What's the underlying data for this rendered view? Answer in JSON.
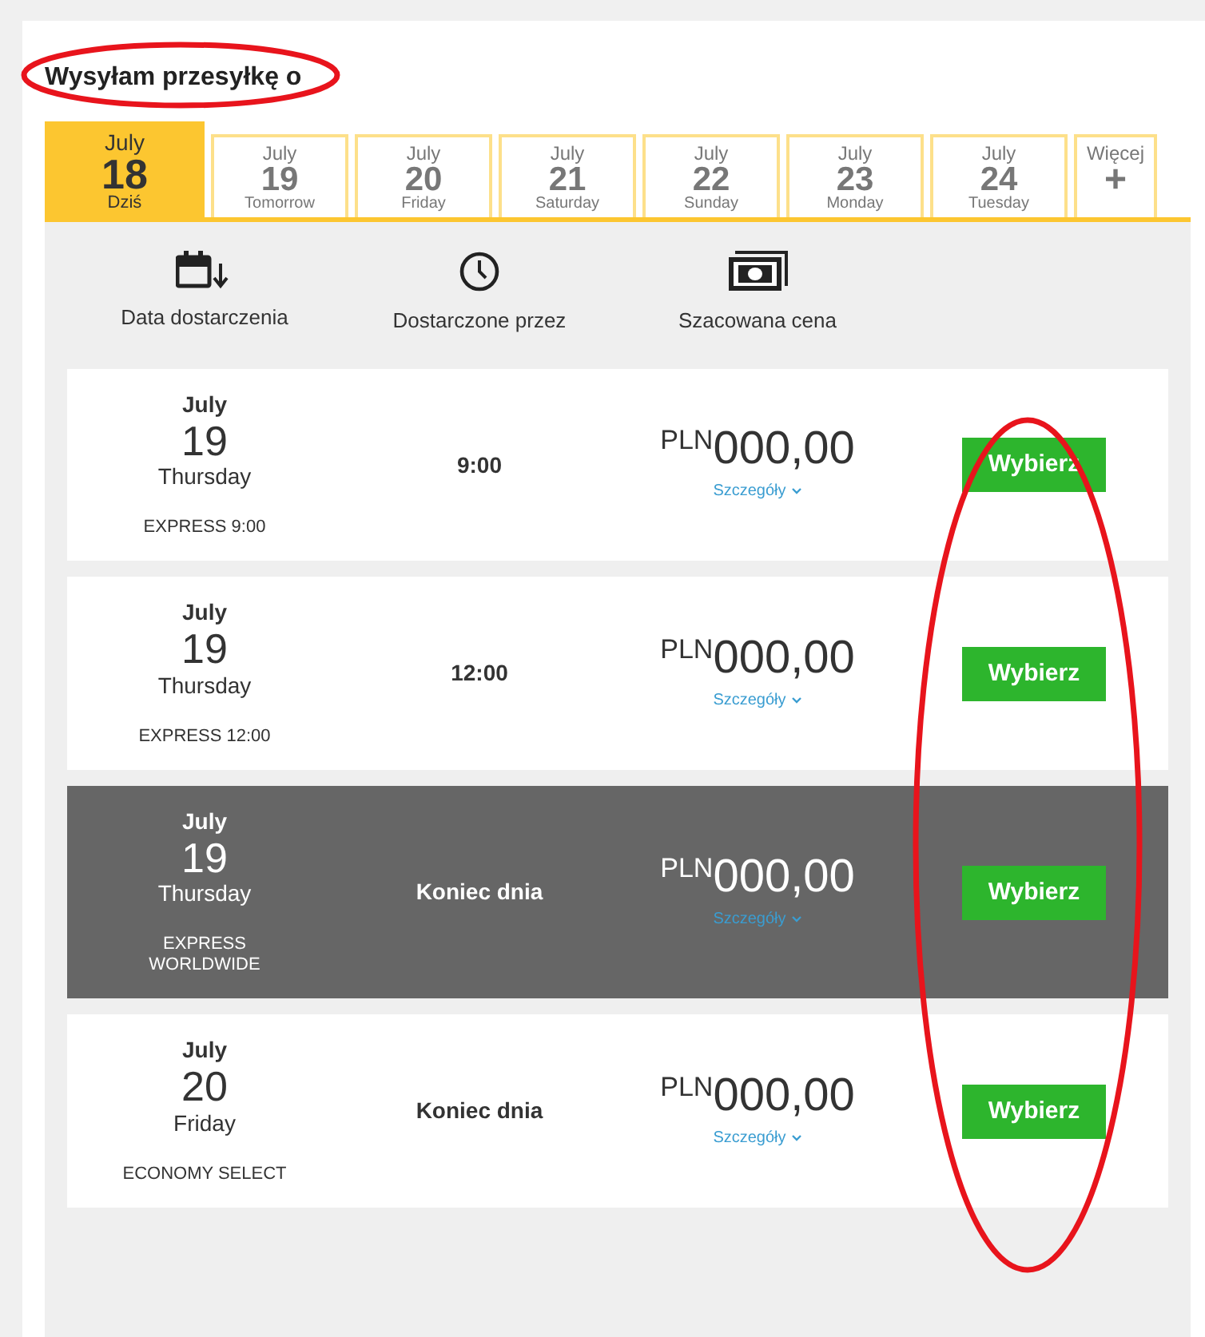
{
  "title": "Wysyłam przesyłkę o",
  "tabs": [
    {
      "kind": "date",
      "month": "July",
      "day": "18",
      "sub": "Dziś",
      "selected": true
    },
    {
      "kind": "date",
      "month": "July",
      "day": "19",
      "sub": "Tomorrow",
      "selected": false
    },
    {
      "kind": "date",
      "month": "July",
      "day": "20",
      "sub": "Friday",
      "selected": false
    },
    {
      "kind": "date",
      "month": "July",
      "day": "21",
      "sub": "Saturday",
      "selected": false
    },
    {
      "kind": "date",
      "month": "July",
      "day": "22",
      "sub": "Sunday",
      "selected": false
    },
    {
      "kind": "date",
      "month": "July",
      "day": "23",
      "sub": "Monday",
      "selected": false
    },
    {
      "kind": "date",
      "month": "July",
      "day": "24",
      "sub": "Tuesday",
      "selected": false
    },
    {
      "kind": "more",
      "label": "Więcej",
      "symbol": "+",
      "selected": false
    }
  ],
  "columns": [
    {
      "kind": "calendar",
      "label": "Data dostarczenia"
    },
    {
      "kind": "clock",
      "label": "Dostarczone przez"
    },
    {
      "kind": "money",
      "label": "Szacowana cena"
    }
  ],
  "rows": [
    {
      "month": "July",
      "day": "19",
      "weekday": "Thursday",
      "service": "EXPRESS 9:00",
      "time": "9:00",
      "currency": "PLN",
      "amount": "000,00",
      "details": "Szczegóły",
      "button": "Wybierz",
      "highlighted": false
    },
    {
      "month": "July",
      "day": "19",
      "weekday": "Thursday",
      "service": "EXPRESS 12:00",
      "time": "12:00",
      "currency": "PLN",
      "amount": "000,00",
      "details": "Szczegóły",
      "button": "Wybierz",
      "highlighted": false
    },
    {
      "month": "July",
      "day": "19",
      "weekday": "Thursday",
      "service": "EXPRESS WORLDWIDE",
      "time": "Koniec dnia",
      "currency": "PLN",
      "amount": "000,00",
      "details": "Szczegóły",
      "button": "Wybierz",
      "highlighted": true
    },
    {
      "month": "July",
      "day": "20",
      "weekday": "Friday",
      "service": "ECONOMY SELECT",
      "time": "Koniec dnia",
      "currency": "PLN",
      "amount": "000,00",
      "details": "Szczegóły",
      "button": "Wybierz",
      "highlighted": false
    }
  ]
}
